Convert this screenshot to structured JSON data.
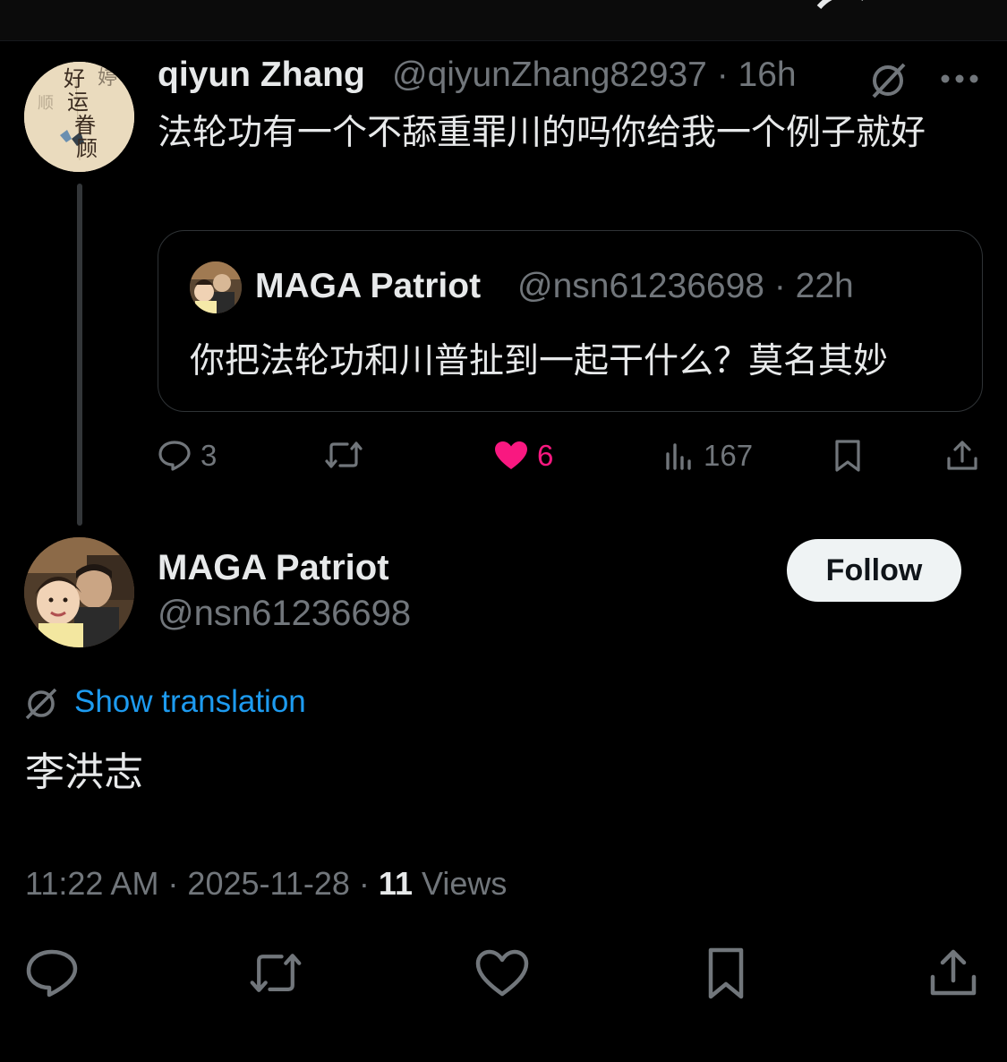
{
  "colors": {
    "background": "#000000",
    "text": "#e7e9ea",
    "muted": "#71767b",
    "link": "#1d9bf0",
    "like": "#f91880",
    "border": "#2f3336"
  },
  "parent_tweet": {
    "author_name": "qiyun Zhang",
    "handle_time": "@qiyunZhang82937 · 16h",
    "text": "法轮功有一个不舔重罪川的吗你给我一个例子就好",
    "avatar_text": [
      "好",
      "运",
      "眷",
      "顾"
    ],
    "quote": {
      "author_name": "MAGA Patriot",
      "handle_time": "@nsn61236698 · 22h",
      "text": "你把法轮功和川普扯到一起干什么？莫名其妙"
    },
    "actions": {
      "replies": "3",
      "likes": "6",
      "views": "167"
    }
  },
  "main_tweet": {
    "author_name": "MAGA Patriot",
    "handle": "@nsn61236698",
    "follow_label": "Follow",
    "show_translation": "Show translation",
    "text": "李洪志",
    "meta_time": "11:22 AM · 2025-11-28 · ",
    "views_count": "11",
    "views_label": " Views"
  },
  "icons": [
    "back-arrow-icon",
    "grok-icon",
    "translate-icon",
    "more-icon",
    "reply-icon",
    "retweet-icon",
    "heart-icon",
    "views-icon",
    "bookmark-icon",
    "share-icon"
  ]
}
